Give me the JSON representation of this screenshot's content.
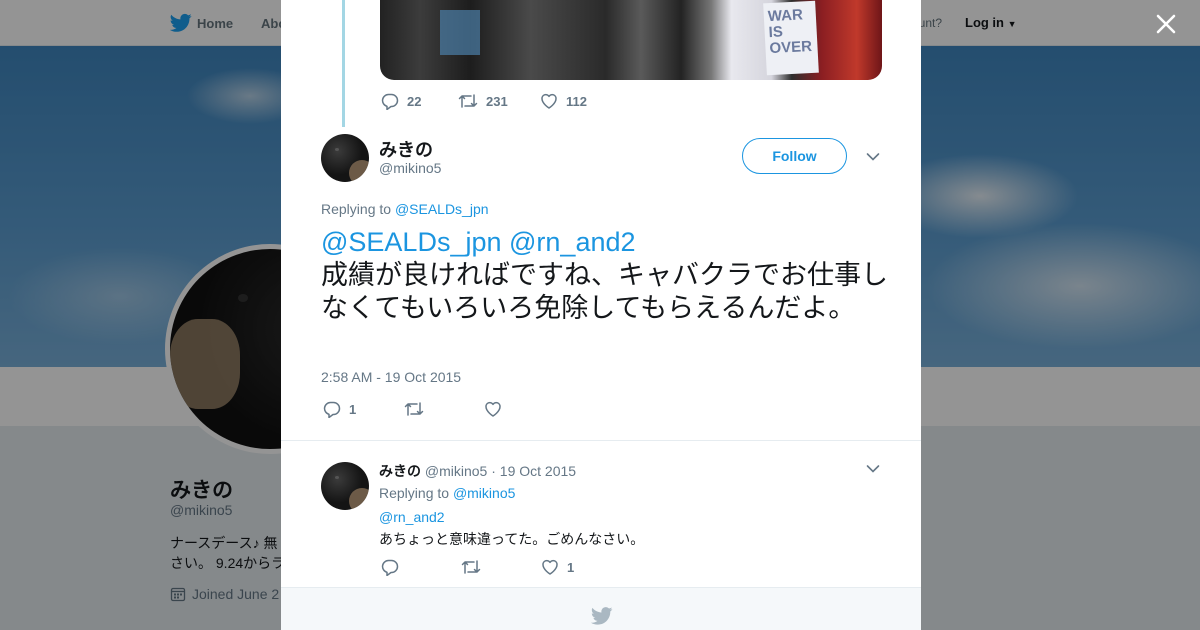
{
  "topbar": {
    "home_label": "Home",
    "about_label": "Abo",
    "account_text": "ccount?",
    "login_label": "Log in"
  },
  "profile": {
    "name": "みきの",
    "handle": "@mikino5",
    "bio_line1": "ナースデース♪ 無",
    "bio_line2": "さい。 9.24からラ",
    "joined": "Joined June 2"
  },
  "previous_tweet": {
    "sign_text": "WAR IS OVER",
    "replies": "22",
    "retweets": "231",
    "likes": "112"
  },
  "main_tweet": {
    "author_name": "みきの",
    "author_handle": "@mikino5",
    "follow_label": "Follow",
    "replying_prefix": "Replying to",
    "replying_to": "@SEALDs_jpn",
    "mention1": "@SEALDs_jpn",
    "mention2": "@rn_and2",
    "text": "成績が良ければですね、キャバクラでお仕事しなくてもいろいろ免除してもらえるんだよ。",
    "timestamp": "2:58 AM - 19 Oct 2015",
    "replies": "1",
    "retweets": "",
    "likes": ""
  },
  "reply_tweet": {
    "author_name": "みきの",
    "author_handle": "@mikino5",
    "separator": "·",
    "date": "19 Oct 2015",
    "replying_prefix": "Replying to",
    "replying_to": "@mikino5",
    "mention": "@rn_and2",
    "text": "あちょっと意味違ってた。ごめんなさい。",
    "replies": "",
    "retweets": "",
    "likes": "1"
  },
  "colors": {
    "accent": "#1b95e0",
    "thread_line": "#a3d6e4",
    "muted": "#657786"
  },
  "icons": [
    "twitter-bird-icon",
    "reply-icon",
    "retweet-icon",
    "like-icon",
    "chevron-down-icon",
    "close-icon",
    "calendar-icon"
  ]
}
